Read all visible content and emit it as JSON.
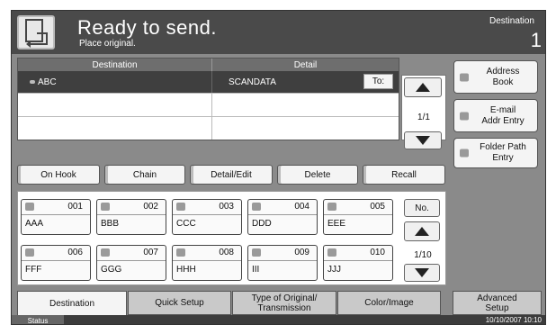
{
  "header": {
    "title": "Ready to send.",
    "subtitle": "Place original.",
    "destination_label": "Destination",
    "destination_count": "1"
  },
  "dest_table": {
    "col_destination": "Destination",
    "col_detail": "Detail",
    "rows": [
      {
        "destination": "ABC",
        "detail": "SCANDATA",
        "to_label": "To:"
      }
    ],
    "page": "1/1"
  },
  "side_buttons": {
    "address_book": "Address\nBook",
    "email_entry": "E-mail\nAddr Entry",
    "folder_entry": "Folder Path\nEntry"
  },
  "actions": {
    "on_hook": "On Hook",
    "chain": "Chain",
    "detail_edit": "Detail/Edit",
    "delete": "Delete",
    "recall": "Recall"
  },
  "keys": [
    {
      "num": "001",
      "name": "AAA",
      "type": "email-icon"
    },
    {
      "num": "002",
      "name": "BBB",
      "type": "email-icon"
    },
    {
      "num": "003",
      "name": "CCC",
      "type": "email-icon"
    },
    {
      "num": "004",
      "name": "DDD",
      "type": "email-icon"
    },
    {
      "num": "005",
      "name": "EEE",
      "type": "email-icon"
    },
    {
      "num": "006",
      "name": "FFF",
      "type": "folder-icon"
    },
    {
      "num": "007",
      "name": "GGG",
      "type": "folder-icon"
    },
    {
      "num": "008",
      "name": "HHH",
      "type": "folder-icon"
    },
    {
      "num": "009",
      "name": "III",
      "type": "folder-icon"
    },
    {
      "num": "010",
      "name": "JJJ",
      "type": "folder-icon"
    }
  ],
  "keys_nav": {
    "no_label": "No.",
    "page": "1/10"
  },
  "tabs": {
    "destination": "Destination",
    "quick_setup": "Quick Setup",
    "type_original": "Type of Original/\nTransmission",
    "color_image": "Color/Image",
    "advanced_setup": "Advanced\nSetup"
  },
  "status": {
    "label": "Status",
    "datetime": "10/10/2007  10:10"
  },
  "colors": {
    "header": "#4a4a4a",
    "selected_row": "#3f3f3f",
    "background": "#8a8a8a"
  }
}
